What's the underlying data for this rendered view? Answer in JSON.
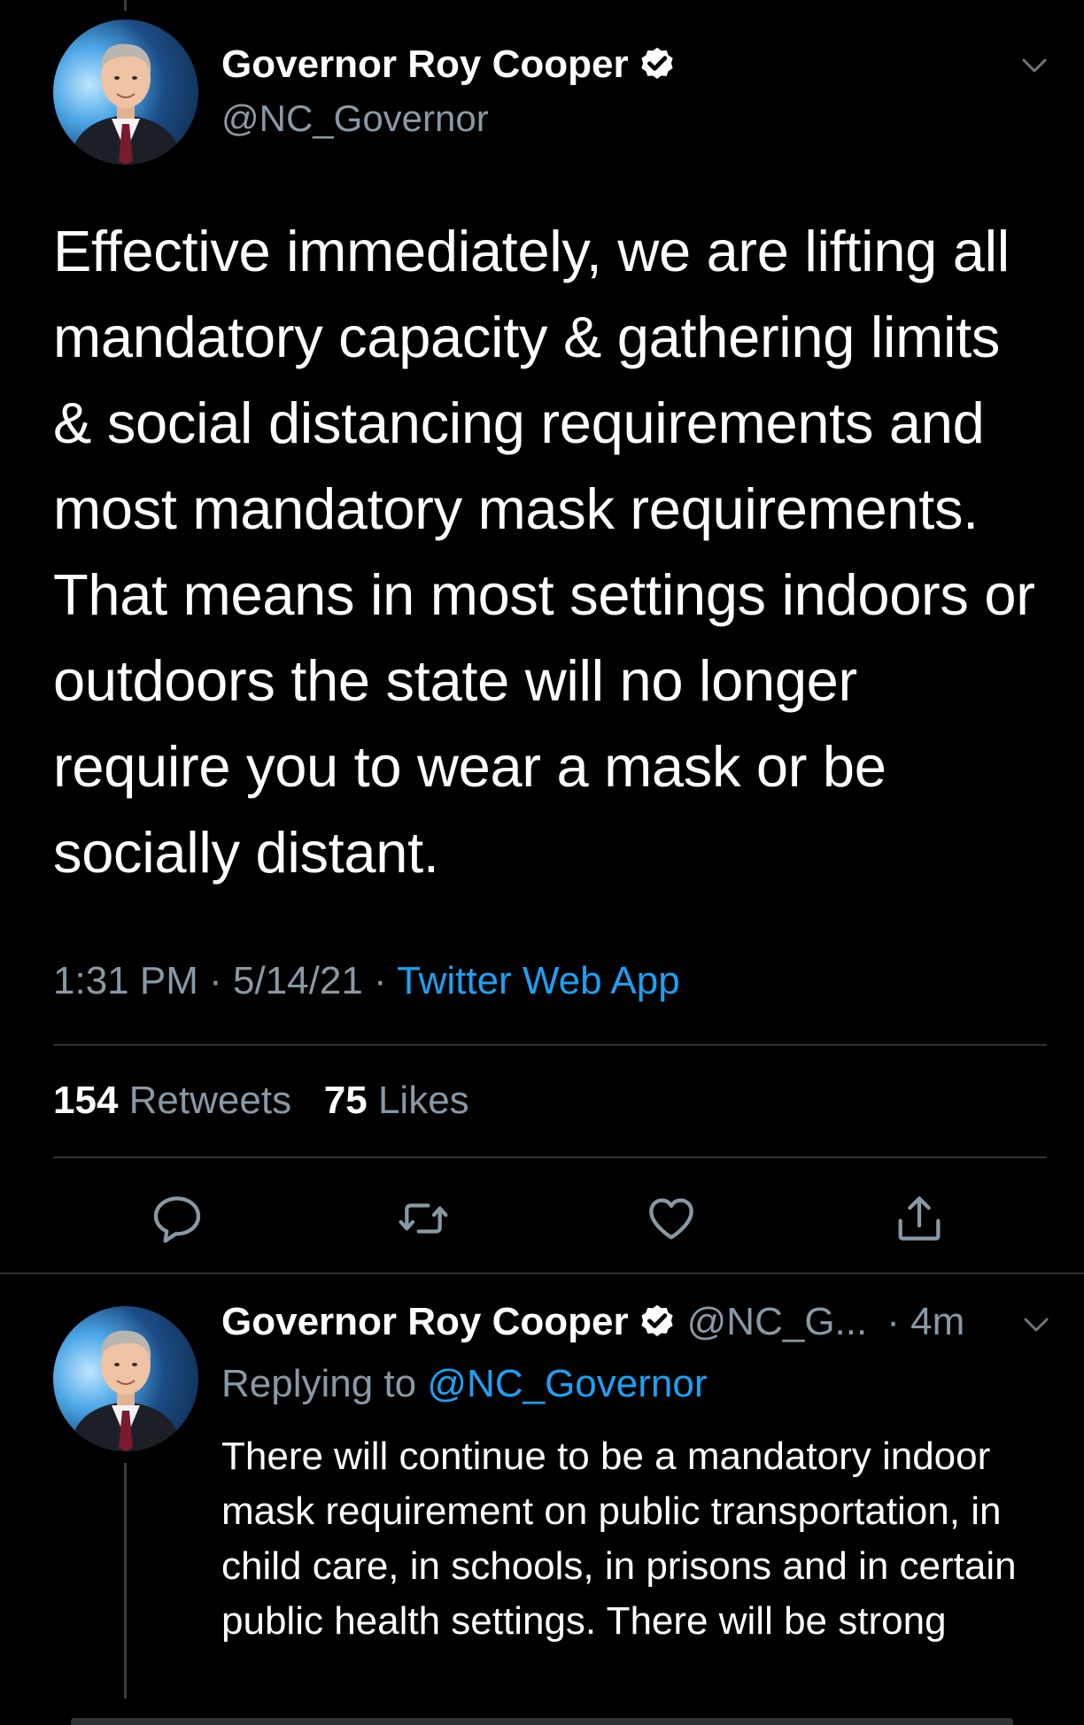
{
  "main_tweet": {
    "display_name": "Governor Roy Cooper",
    "handle": "@NC_Governor",
    "avatar_icon": "profile-photo",
    "verified_icon": "verified-badge-icon",
    "text": "Effective immediately, we are lifting all mandatory capacity & gathering limits & social distancing requirements and most mandatory mask requirements. That means in most settings indoors or outdoors the state will no longer require you to wear a mask or be socially distant.",
    "time": "1:31 PM",
    "date": "5/14/21",
    "separator": "·",
    "source": "Twitter Web App",
    "retweets_count": "154",
    "retweets_label": "Retweets",
    "likes_count": "75",
    "likes_label": "Likes"
  },
  "actions": [
    {
      "name": "reply",
      "icon": "reply-icon"
    },
    {
      "name": "retweet",
      "icon": "retweet-icon"
    },
    {
      "name": "like",
      "icon": "heart-icon"
    },
    {
      "name": "share",
      "icon": "share-icon"
    }
  ],
  "reply_tweet": {
    "display_name": "Governor Roy Cooper",
    "handle": "@NC_G...",
    "time": "· 4m",
    "replying_to_label": "Replying to",
    "replying_to_handle": "@NC_Governor",
    "text": "There will continue to be a mandatory indoor mask requirement on public transportation, in child care, in schools, in prisons and in certain public health settings. There will be strong"
  },
  "colors": {
    "background": "#000000",
    "text_primary": "#ffffff",
    "text_secondary": "#8899a6",
    "accent": "#1da1f2",
    "divider": "#2f3336"
  }
}
